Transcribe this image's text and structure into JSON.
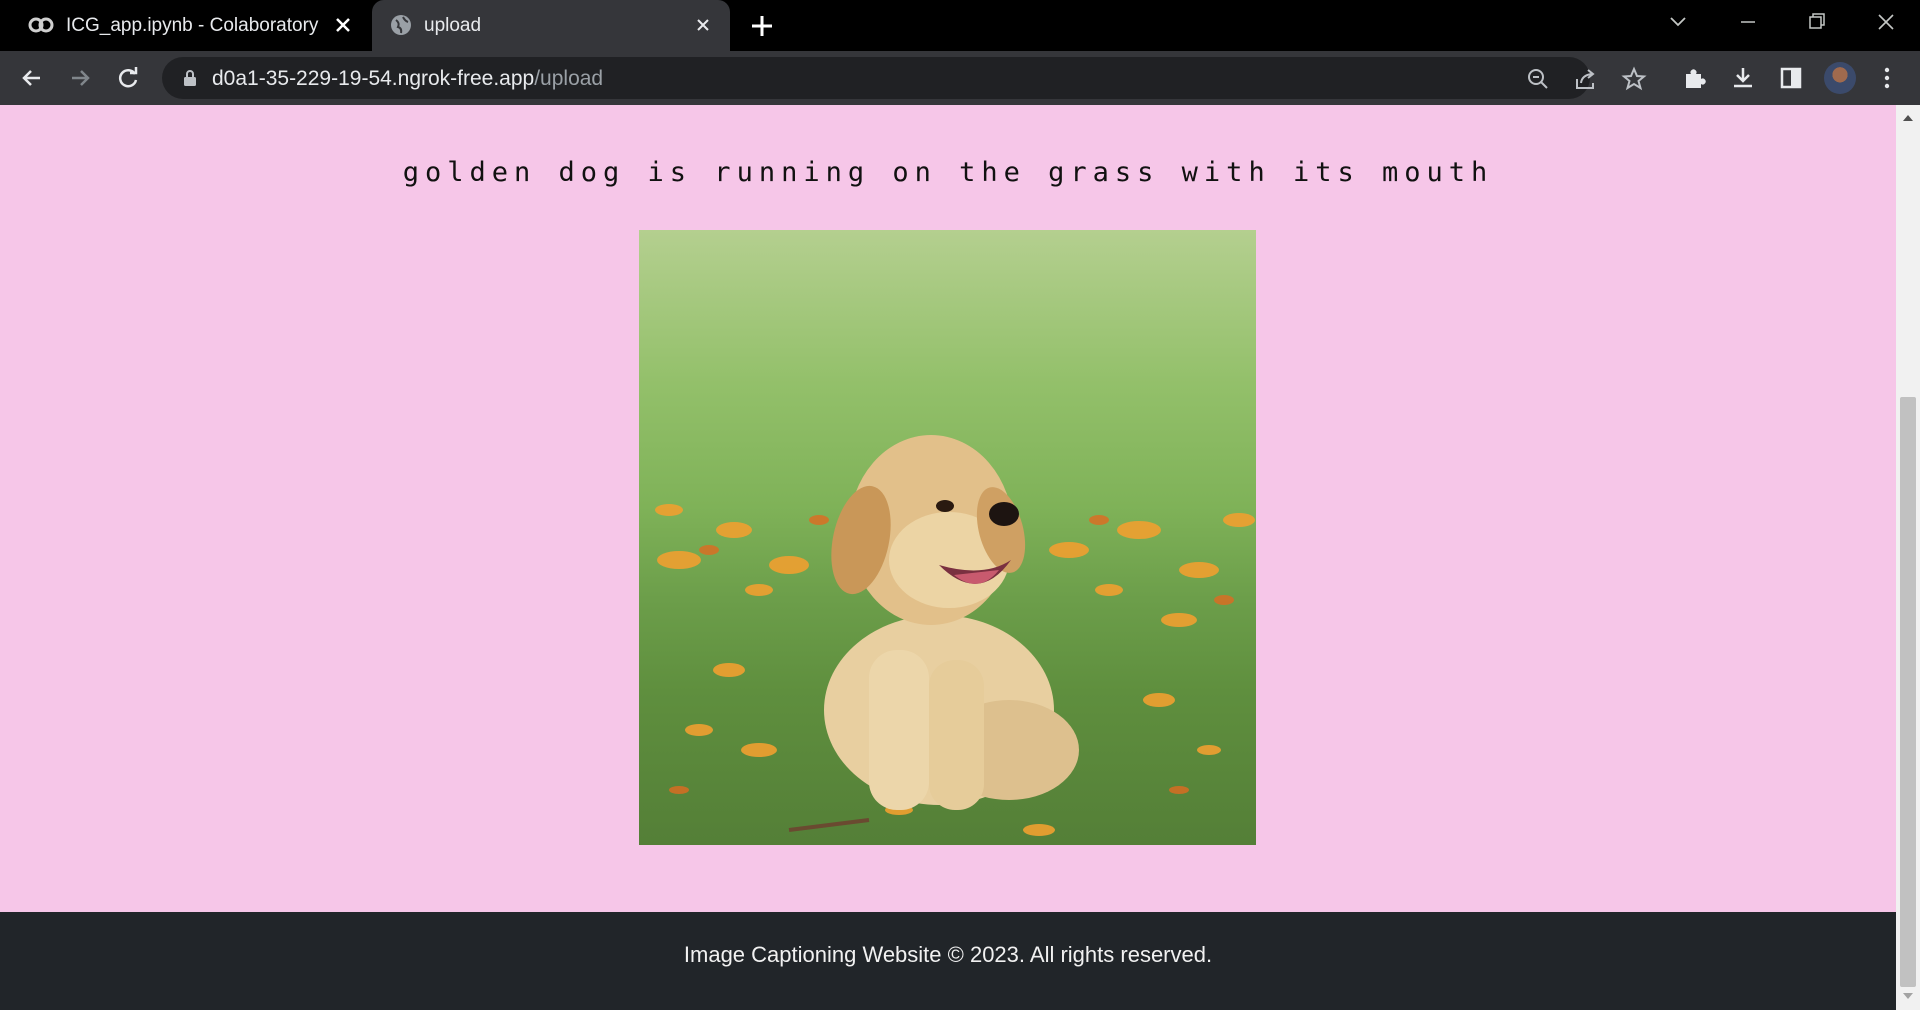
{
  "tabs": [
    {
      "title": "ICG_app.ipynb - Colaboratory",
      "icon": "colab-icon",
      "active": false
    },
    {
      "title": "upload",
      "icon": "globe-icon",
      "active": true
    }
  ],
  "address_bar": {
    "host": "d0a1-35-229-19-54.ngrok-free.app",
    "path": "/upload"
  },
  "page": {
    "caption": "golden dog is running on the grass with its mouth",
    "image": {
      "subject": "golden retriever puppy sitting in grass with orange flowers"
    },
    "footer": "Image Captioning Website © 2023. All rights reserved."
  },
  "colors": {
    "page_background": "#f6c6e8",
    "footer_background": "#212529",
    "tab_strip": "#000000",
    "toolbar": "#35363a"
  }
}
